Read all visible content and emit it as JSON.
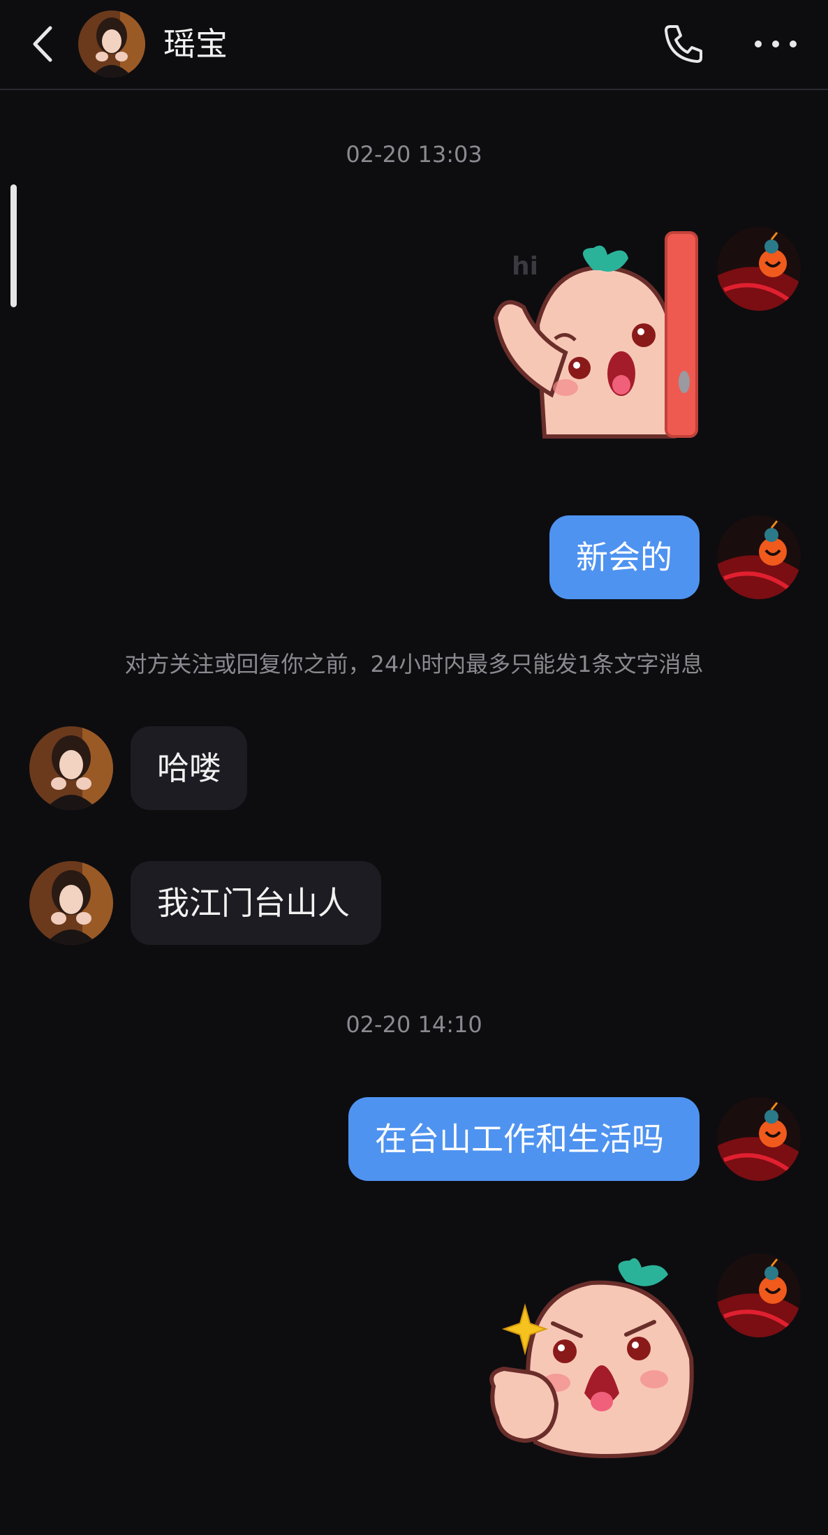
{
  "header": {
    "contact_name": "瑶宝",
    "back_icon": "chevron-left-icon",
    "call_icon": "phone-icon",
    "more_icon": "more-dots-icon"
  },
  "colors": {
    "background": "#0d0d10",
    "outgoing_bubble": "#4f93f0",
    "incoming_bubble": "#1c1c22",
    "meta_text": "#8a8a90"
  },
  "messages": {
    "time_1": "02-20 13:03",
    "sticker_1_text": "hi",
    "out_1": "新会的",
    "notice": "对方关注或回复你之前，24小时内最多只能发1条文字消息",
    "in_1": "哈喽",
    "in_2": "我江门台山人",
    "time_2": "02-20 14:10",
    "out_2": "在台山工作和生活吗"
  }
}
